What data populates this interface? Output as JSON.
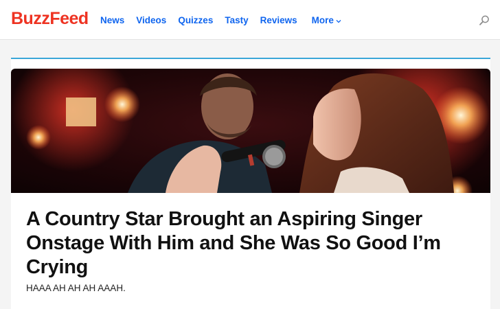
{
  "site": {
    "logo_text": "BuzzFeed",
    "brand_color": "#ee3322",
    "link_color": "#0f65ef"
  },
  "nav": {
    "items": [
      {
        "label": "News"
      },
      {
        "label": "Videos"
      },
      {
        "label": "Quizzes"
      },
      {
        "label": "Tasty"
      },
      {
        "label": "Reviews"
      }
    ],
    "more_label": "More",
    "more_icon": "chevron-down-icon",
    "search_icon": "search-icon"
  },
  "article": {
    "headline": "A Country Star Brought an Aspiring Singer Onstage With Him and She Was So Good I’m Crying",
    "dek": "HAAA AH AH AH AAAH.",
    "accent_color": "#3aa6d8"
  }
}
